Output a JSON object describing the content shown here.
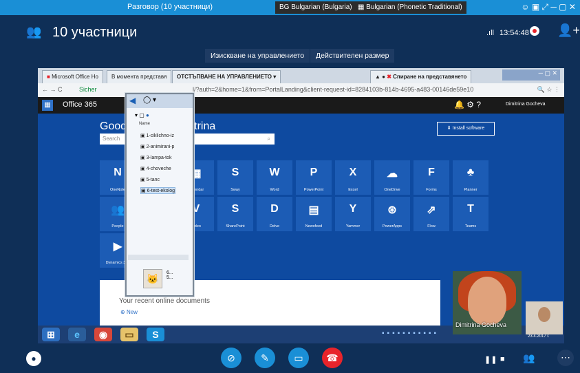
{
  "window": {
    "title": "Разговор (10 участници)",
    "lang_indicator": "BG Bulgarian (Bulgaria)",
    "keyboard": "Bulgarian (Phonetic Traditional)"
  },
  "call": {
    "participants_label": "10 участници",
    "signal": ".ıll",
    "time": "13:54:48",
    "request_control": "Изискване на управлението",
    "actual_size": "Действителен размер"
  },
  "browser": {
    "tab1": "Microsoft Office Ho",
    "tab2": "В момента представя",
    "tab3": "ОТСТЪПВАНЕ НА УПРАВЛЕНИЕТО",
    "tab4": "Спиране на представянето",
    "secure": "Sicher",
    "url": "l/?auth=2&home=1&from=PortalLanding&client-request-id=8284103b-814b-4695-a483-00146de59e10"
  },
  "office": {
    "title": "Office 365",
    "user": "Dimitrina Gocheva",
    "greeting": "Good",
    "greeting_suffix": "trina",
    "search_placeholder": "Search",
    "install": "Install software",
    "apps_row1": [
      "OneNote",
      "",
      "Calendar",
      "Sway",
      "Word",
      "PowerPoint",
      "Excel",
      "OneDrive",
      "Forms",
      "Planner"
    ],
    "apps_row2": [
      "People",
      "",
      "Video",
      "SharePoint",
      "Delve",
      "Newsfeed",
      "Yammer",
      "PowerApps",
      "Flow",
      "Teams"
    ],
    "apps_row3": [
      "Dynamics 365"
    ],
    "recent_title": "Your recent online documents",
    "new_label": "New"
  },
  "file_window": {
    "column_name": "Name",
    "files": [
      "1-ciklichno-iz",
      "2-animirani-p",
      "3-lampa-tok",
      "4-choveche",
      "5-tanc",
      "6-test-ekolog"
    ],
    "selected_index": 5
  },
  "taskbar": {
    "date": "23.4.2017 г."
  },
  "video": {
    "main_name": "Dimitrina Gocheva"
  },
  "colors": {
    "skype_blue": "#1a8fd6",
    "hangup_red": "#e8242b",
    "office_blue": "#0e4aa0"
  }
}
